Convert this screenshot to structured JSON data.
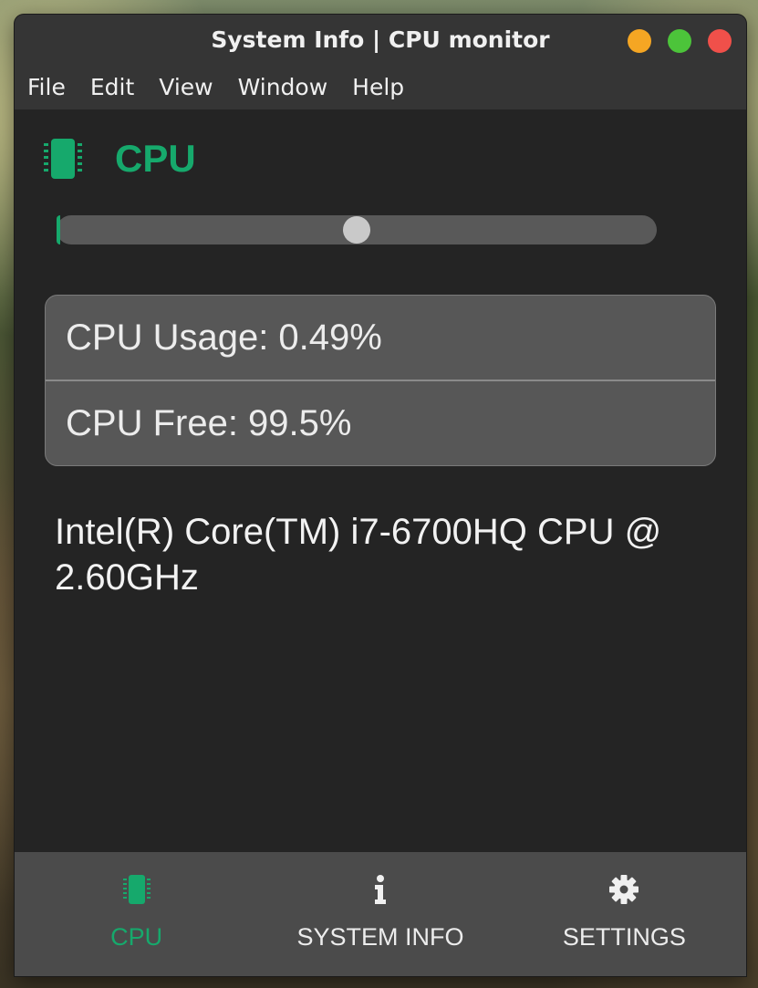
{
  "window": {
    "title": "System Info | CPU monitor",
    "controls": {
      "minimize_color": "#f5a623",
      "maximize_color": "#4cc43a",
      "close_color": "#f0504a"
    }
  },
  "menubar": {
    "items": [
      "File",
      "Edit",
      "View",
      "Window",
      "Help"
    ]
  },
  "cpu_panel": {
    "heading": "CPU",
    "icon": "chip-icon",
    "accent_color": "#16a96c",
    "usage_fill_fraction": 0.0049,
    "slider_thumb_fraction": 0.5,
    "usage_label": "CPU Usage: 0.49%",
    "free_label": "CPU Free: 99.5%",
    "model": "Intel(R) Core(TM) i7-6700HQ CPU @ 2.60GHz"
  },
  "bottom_nav": {
    "tabs": [
      {
        "label": "CPU",
        "icon": "chip-icon",
        "active": true
      },
      {
        "label": "SYSTEM INFO",
        "icon": "info-icon",
        "active": false
      },
      {
        "label": "SETTINGS",
        "icon": "gear-icon",
        "active": false
      }
    ]
  }
}
